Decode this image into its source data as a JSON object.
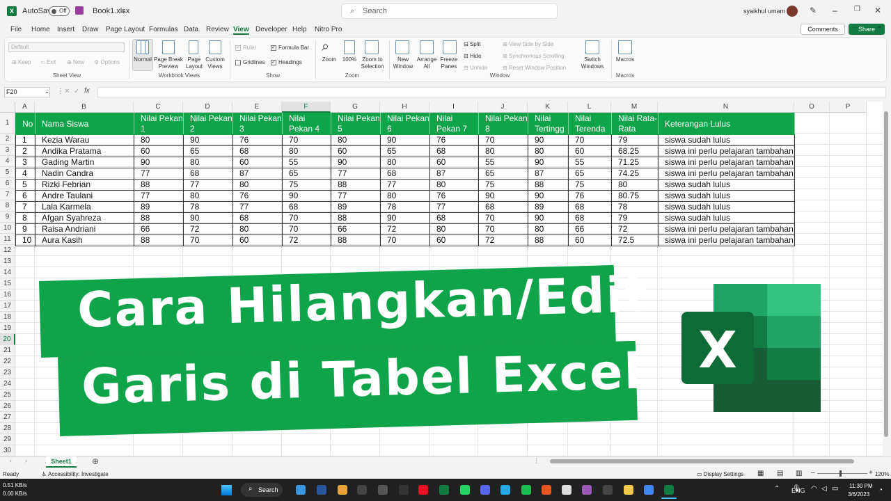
{
  "titlebar": {
    "autosave_label": "AutoSave",
    "autosave_state": "Off",
    "filename": "Book1.xlsx",
    "search_placeholder": "Search",
    "user": "syaikhul umam"
  },
  "menu": [
    "File",
    "Home",
    "Insert",
    "Draw",
    "Page Layout",
    "Formulas",
    "Data",
    "Review",
    "View",
    "Developer",
    "Help",
    "Nitro Pro"
  ],
  "menu_active": "View",
  "comments_label": "Comments",
  "share_label": "Share",
  "ribbon": {
    "sheetview": {
      "dropdown": "Default",
      "keep": "Keep",
      "exit": "Exit",
      "new": "New",
      "options": "Options",
      "label": "Sheet View"
    },
    "workbookviews": {
      "normal": "Normal",
      "pagebreak": "Page Break Preview",
      "pagelayout": "Page Layout",
      "custom": "Custom Views",
      "label": "Workbook Views"
    },
    "show": {
      "ruler": "Ruler",
      "formulabar": "Formula Bar",
      "gridlines": "Gridlines",
      "headings": "Headings",
      "label": "Show"
    },
    "zoom": {
      "zoom": "Zoom",
      "hundred": "100%",
      "selection": "Zoom to Selection",
      "label": "Zoom"
    },
    "window": {
      "newwindow": "New Window",
      "arrange": "Arrange All",
      "freeze": "Freeze Panes",
      "split": "Split",
      "hide": "Hide",
      "unhide": "Unhide",
      "sidebyside": "View Side by Side",
      "sync": "Synchronous Scrolling",
      "reset": "Reset Window Position",
      "switch": "Switch Windows",
      "label": "Window"
    },
    "macros": {
      "macros": "Macros",
      "label": "Macros"
    }
  },
  "namebox": "F20",
  "columns": [
    "A",
    "B",
    "C",
    "D",
    "E",
    "F",
    "G",
    "H",
    "I",
    "J",
    "K",
    "L",
    "M",
    "N",
    "O",
    "P"
  ],
  "selected_column": "F",
  "rows": [
    "1",
    "2",
    "3",
    "4",
    "5",
    "6",
    "7",
    "8",
    "9",
    "10",
    "11",
    "12",
    "13",
    "14",
    "15",
    "16",
    "17",
    "18",
    "19",
    "20",
    "21",
    "22",
    "23",
    "24",
    "25",
    "26",
    "27",
    "28",
    "29",
    "30"
  ],
  "selected_row": "20",
  "table": {
    "headers": [
      "No",
      "Nama Siswa",
      "Nilai Pekan 1",
      "Nilai Pekan 2",
      "Nilai Pekan 3",
      "Nilai Pekan 4",
      "Nilai Pekan 5",
      "Nilai Pekan 6",
      "Nilai Pekan 7",
      "Nilai Pekan 8",
      "Nilai Tertingg",
      "Nilai Terenda",
      "Nilai Rata-Rata",
      "Keterangan Lulus"
    ],
    "rows": [
      [
        "1",
        "Kezia Warau",
        "80",
        "90",
        "76",
        "70",
        "80",
        "90",
        "76",
        "70",
        "90",
        "70",
        "79",
        "siswa sudah lulus"
      ],
      [
        "2",
        "Andika Pratama",
        "60",
        "65",
        "68",
        "80",
        "60",
        "65",
        "68",
        "80",
        "80",
        "60",
        "68.25",
        "siswa ini perlu pelajaran tambahan"
      ],
      [
        "3",
        "Gading Martin",
        "90",
        "80",
        "60",
        "55",
        "90",
        "80",
        "60",
        "55",
        "90",
        "55",
        "71.25",
        "siswa ini perlu pelajaran tambahan"
      ],
      [
        "4",
        "Nadin Candra",
        "77",
        "68",
        "87",
        "65",
        "77",
        "68",
        "87",
        "65",
        "87",
        "65",
        "74.25",
        "siswa ini perlu pelajaran tambahan"
      ],
      [
        "5",
        "Rizki Febrian",
        "88",
        "77",
        "80",
        "75",
        "88",
        "77",
        "80",
        "75",
        "88",
        "75",
        "80",
        "siswa sudah lulus"
      ],
      [
        "6",
        "Andre Taulani",
        "77",
        "80",
        "76",
        "90",
        "77",
        "80",
        "76",
        "90",
        "90",
        "76",
        "80.75",
        "siswa sudah lulus"
      ],
      [
        "7",
        "Lala Karmela",
        "89",
        "78",
        "77",
        "68",
        "89",
        "78",
        "77",
        "68",
        "89",
        "68",
        "78",
        "siswa sudah lulus"
      ],
      [
        "8",
        "Afgan Syahreza",
        "88",
        "90",
        "68",
        "70",
        "88",
        "90",
        "68",
        "70",
        "90",
        "68",
        "79",
        "siswa sudah lulus"
      ],
      [
        "9",
        "Raisa Andriani",
        "66",
        "72",
        "80",
        "70",
        "66",
        "72",
        "80",
        "70",
        "80",
        "66",
        "72",
        "siswa ini perlu pelajaran tambahan"
      ],
      [
        "10",
        "Aura Kasih",
        "88",
        "70",
        "60",
        "72",
        "88",
        "70",
        "60",
        "72",
        "88",
        "60",
        "72.5",
        "siswa ini perlu pelajaran tambahan"
      ]
    ]
  },
  "banner": {
    "line1": "Cara Hilangkan/Edit",
    "line2": "Garis di Tabel Excel"
  },
  "sheet_tab": "Sheet1",
  "status": {
    "ready": "Ready",
    "accessibility": "Accessibility: Investigate",
    "display": "Display Settings",
    "zoom": "120%"
  },
  "taskbar": {
    "net_up": "0.51 KB/s",
    "net_down": "0.00 KB/s",
    "search": "Search",
    "lang": "ENG",
    "time": "11:30 PM",
    "date": "3/6/2023"
  },
  "colors": {
    "accent": "#107c41",
    "table_header": "#0fa34a"
  }
}
